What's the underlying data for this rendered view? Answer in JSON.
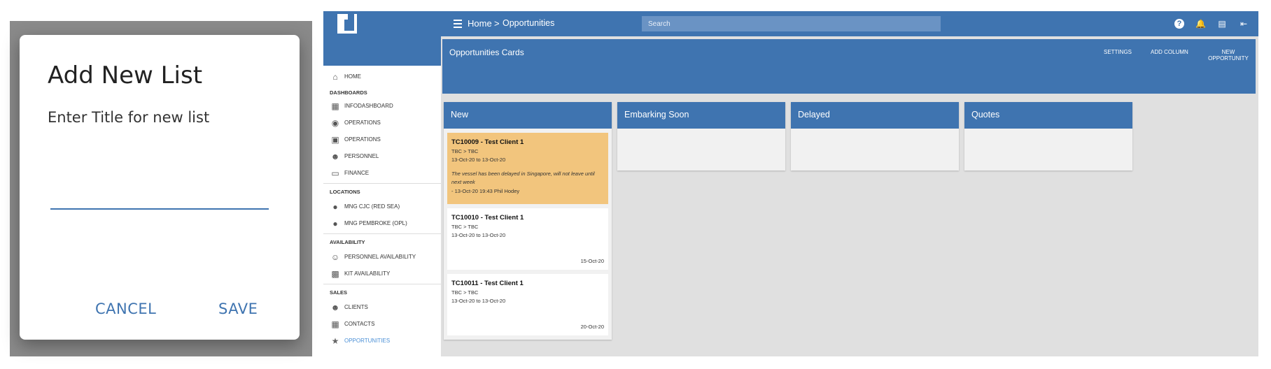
{
  "dialog": {
    "title": "Add New List",
    "prompt": "Enter Title for new list",
    "input_value": "",
    "cancel_label": "CANCEL",
    "save_label": "SAVE"
  },
  "topbar": {
    "breadcrumb_home": "Home",
    "breadcrumb_sep": ">",
    "breadcrumb_current": "Opportunities",
    "search_placeholder": "Search",
    "icons": [
      "help-icon",
      "bell-icon",
      "chat-icon",
      "exit-icon"
    ]
  },
  "sidebar": {
    "items": [
      {
        "label": "HOME",
        "icon": "home-icon"
      },
      {
        "label": "INFODASHBOARD",
        "icon": "dashboard-icon"
      },
      {
        "label": "OPERATIONS",
        "icon": "globe-icon"
      },
      {
        "label": "OPERATIONS",
        "icon": "folder-icon"
      },
      {
        "label": "PERSONNEL",
        "icon": "people-icon"
      },
      {
        "label": "FINANCE",
        "icon": "card-icon"
      },
      {
        "label": "MNG CJC (RED SEA)",
        "icon": "pin-icon"
      },
      {
        "label": "MNG PEMBROKE (OPL)",
        "icon": "pin-icon"
      },
      {
        "label": "PERSONNEL AVAILABILITY",
        "icon": "person-icon"
      },
      {
        "label": "KIT AVAILABILITY",
        "icon": "briefcase-icon"
      },
      {
        "label": "CLIENTS",
        "icon": "people-icon"
      },
      {
        "label": "CONTACTS",
        "icon": "contact-card-icon"
      },
      {
        "label": "OPPORTUNITIES",
        "icon": "star-icon"
      }
    ],
    "sections": [
      "DASHBOARDS",
      "LOCATIONS",
      "AVAILABILITY",
      "SALES"
    ],
    "active_item": "OPPORTUNITIES",
    "active_color": "#4a8fd6"
  },
  "main": {
    "title": "Opportunities Cards",
    "settings_label": "SETTINGS",
    "add_column_label": "ADD COLUMN",
    "new_opportunity_label": "NEW OPPORTUNITY",
    "columns": [
      {
        "title": "New"
      },
      {
        "title": "Embarking Soon"
      },
      {
        "title": "Delayed"
      },
      {
        "title": "Quotes"
      }
    ],
    "cards": [
      {
        "title": "TC10009 - Test Client 1",
        "route": "TBC > TBC",
        "dates": "13-Oct-20 to 13-Oct-20",
        "note": "The vessel has been delayed in Singapore, will not leave until next week",
        "note_meta": "- 13-Oct-20 19:43 Phil Hodey",
        "highlight": "#f2c57d"
      },
      {
        "title": "TC10010 - Test Client 1",
        "route": "TBC > TBC",
        "dates": "13-Oct-20 to 13-Oct-20",
        "date": "15-Oct-20"
      },
      {
        "title": "TC10011 - Test Client 1",
        "route": "TBC > TBC",
        "dates": "13-Oct-20 to 13-Oct-20",
        "date": "20-Oct-20"
      }
    ]
  },
  "colors": {
    "primary": "#3f74b0",
    "background": "#e0e0e0"
  }
}
